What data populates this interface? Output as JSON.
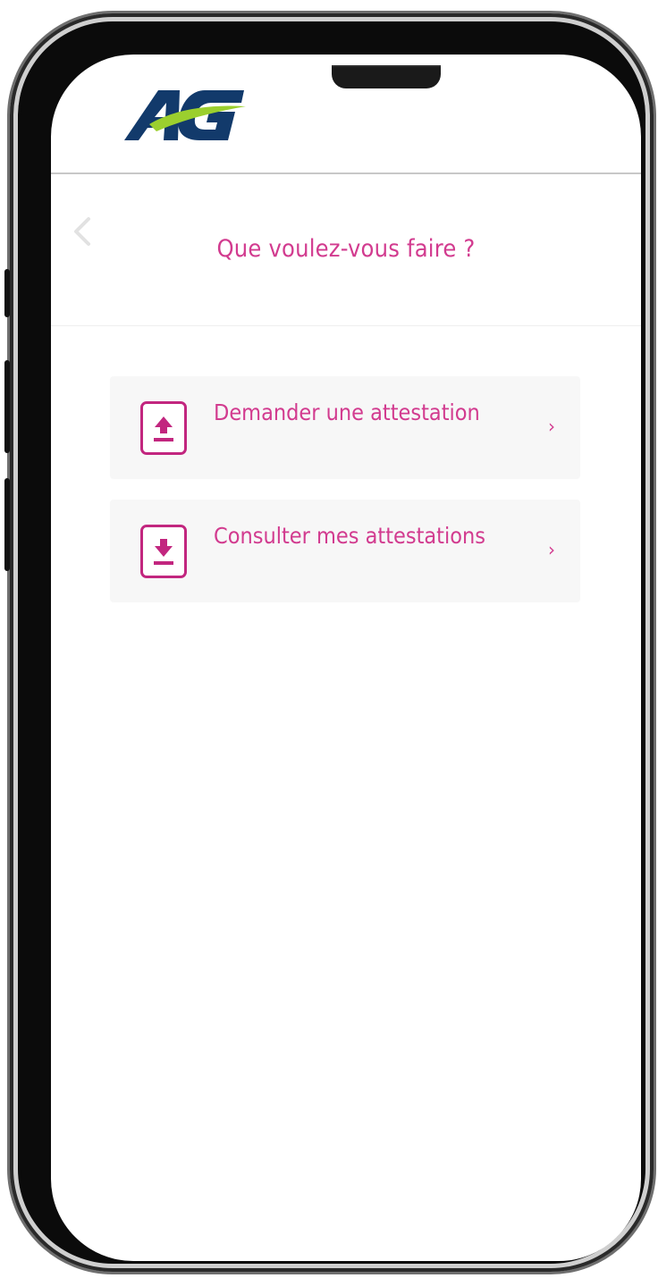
{
  "brand": {
    "logo_text": "AG",
    "colors": {
      "navy": "#123a6b",
      "lime": "#9bcf2e",
      "accent_pink": "#d23b8f",
      "icon_magenta": "#c2267f"
    }
  },
  "header": {
    "back_icon": "chevron-left-icon",
    "title": "Que voulez-vous faire ?"
  },
  "actions": [
    {
      "label": "Demander une attestation",
      "icon": "upload-icon",
      "chevron": "›"
    },
    {
      "label": "Consulter mes attestations",
      "icon": "download-icon",
      "chevron": "›"
    }
  ]
}
